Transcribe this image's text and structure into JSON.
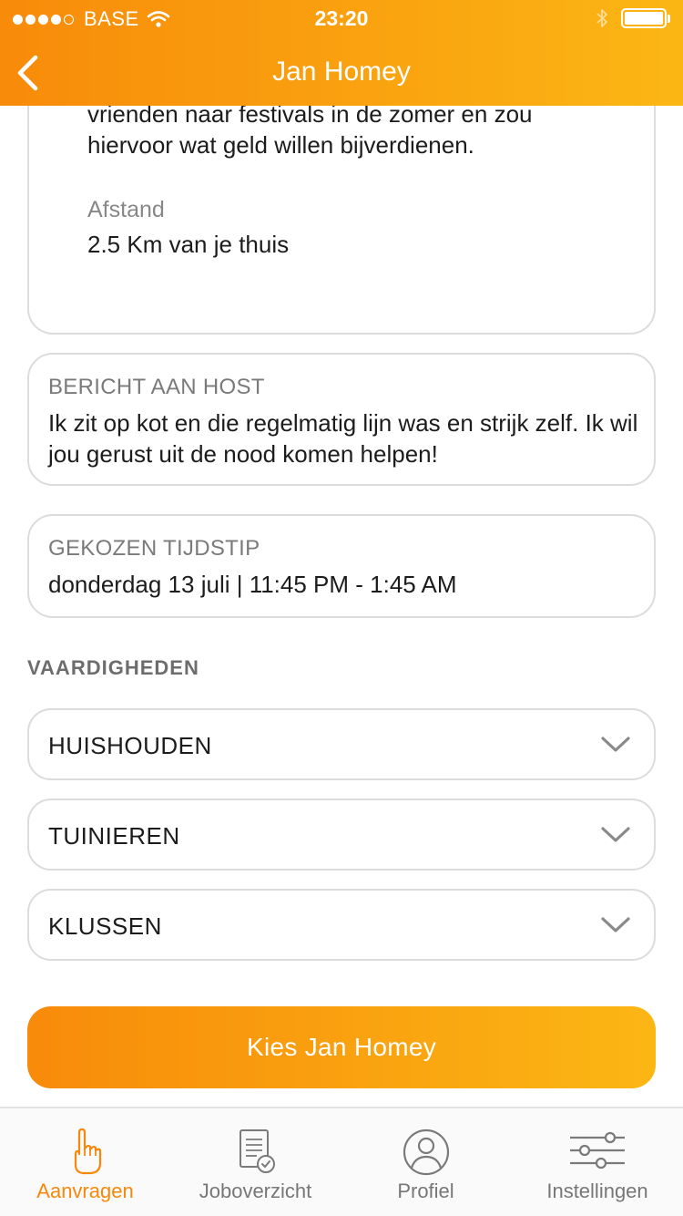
{
  "status_bar": {
    "carrier": "BASE",
    "time": "23:20",
    "signal_strength": 4,
    "signal_max": 5,
    "battery_level": 1.0
  },
  "header": {
    "title": "Jan Homey",
    "back_icon": "chevron-left-icon"
  },
  "profile": {
    "description_lines": [
      "vrienden naar festivals in de zomer en zou",
      "hiervoor wat geld willen bijverdienen."
    ],
    "distance_label": "Afstand",
    "distance_value": "2.5 Km van je thuis"
  },
  "message": {
    "label": "BERICHT AAN HOST",
    "text": "Ik zit op kot en die regelmatig lijn was en strijk zelf. Ik wil jou gerust uit de nood komen helpen!"
  },
  "timeslot": {
    "label": "GEKOZEN TIJDSTIP",
    "value": "donderdag 13 juli | 11:45 PM - 1:45 AM"
  },
  "skills": {
    "title": "VAARDIGHEDEN",
    "items": [
      {
        "label": "HUISHOUDEN",
        "icon": "chevron-down-icon"
      },
      {
        "label": "TUINIEREN",
        "icon": "chevron-down-icon"
      },
      {
        "label": "KLUSSEN",
        "icon": "chevron-down-icon"
      }
    ]
  },
  "cta": {
    "label": "Kies Jan Homey"
  },
  "tabbar": {
    "items": [
      {
        "label": "Aanvragen",
        "icon": "pointing-hand-icon",
        "active": true
      },
      {
        "label": "Joboverzicht",
        "icon": "document-check-icon",
        "active": false
      },
      {
        "label": "Profiel",
        "icon": "user-circle-icon",
        "active": false
      },
      {
        "label": "Instellingen",
        "icon": "sliders-icon",
        "active": false
      }
    ]
  },
  "colors": {
    "accent_start": "#f88b0a",
    "accent_end": "#fbb614",
    "active_tab": "#f7880b",
    "border": "#dcdcdc",
    "caption_gray": "#7a7a7a"
  }
}
